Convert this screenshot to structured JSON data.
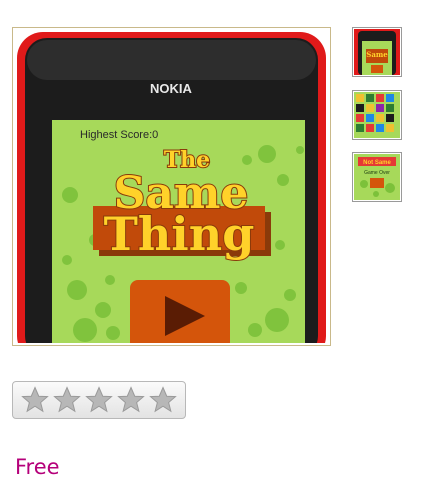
{
  "product": {
    "screen_title_line1": "The",
    "screen_title_line2": "Same",
    "screen_title_line3": "Thing",
    "highest_score": "Highest Score:0",
    "phone_brand": "NOKIA",
    "thumb3_label_top": "Not Same",
    "thumb3_label_sub": "Game Over"
  },
  "rating": {
    "stars_filled": 0,
    "stars_total": 5
  },
  "price": {
    "label": "Free"
  },
  "colors": {
    "price": "#b5007a",
    "phone_red": "#e01a1a",
    "screen_green": "#a7d95a",
    "title_yellow": "#ffd22a",
    "play_orange": "#d4550b"
  }
}
